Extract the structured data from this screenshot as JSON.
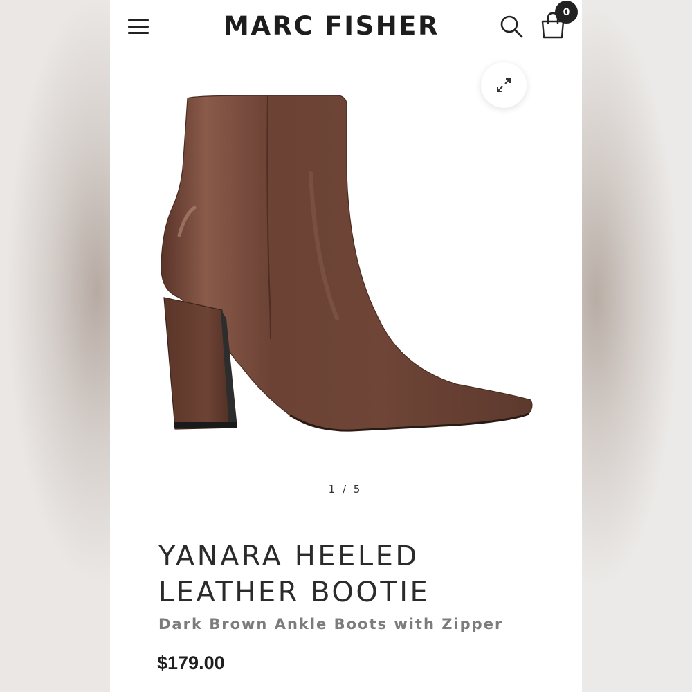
{
  "header": {
    "brand": "MARC FISHER",
    "cart_count": "0",
    "icons": {
      "menu": "hamburger-menu-icon",
      "search": "search-icon",
      "cart": "shopping-bag-icon"
    }
  },
  "gallery": {
    "expand_icon": "expand-icon",
    "pager": "1 / 5",
    "product_color": "#6e4537"
  },
  "product": {
    "title_line1": "YANARA HEELED",
    "title_line2": "LEATHER BOOTIE",
    "subtitle": "Dark Brown Ankle Boots with Zipper",
    "price": "$179.00"
  }
}
